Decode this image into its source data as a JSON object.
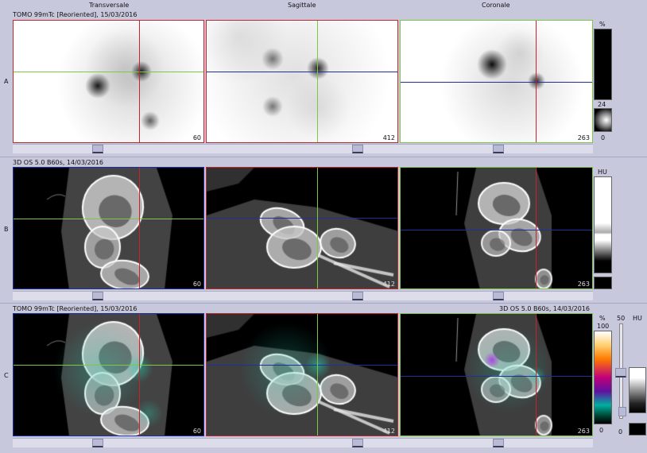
{
  "columns": {
    "transversale": "Transversale",
    "sagittale": "Sagittale",
    "coronale": "Coronale"
  },
  "rows": {
    "A": {
      "letter": "A",
      "series": "TOMO 99mTc [Reoriented], 15/03/2016",
      "unit": "%",
      "scale_top": "24",
      "scale_bottom": "0"
    },
    "B": {
      "letter": "B",
      "series": "3D  OS  5.0  B60s, 14/03/2016",
      "unit": "HU"
    },
    "C": {
      "letter": "C",
      "series_left": "TOMO 99mTc [Reoriented], 15/03/2016",
      "series_right": "3D  OS  5.0  B60s, 14/03/2016",
      "unit_left": "%",
      "unit_mid": "50",
      "unit_right": "HU",
      "scale_top": "100",
      "scale_bottom": "0",
      "ct_bottom": "0"
    }
  },
  "slices": {
    "transversale": "60",
    "sagittale": "412",
    "coronale": "263"
  },
  "colors": {
    "red": "#c0262a",
    "green": "#7ac843",
    "blue": "#1f2f9e",
    "background": "#c8c8dc"
  }
}
